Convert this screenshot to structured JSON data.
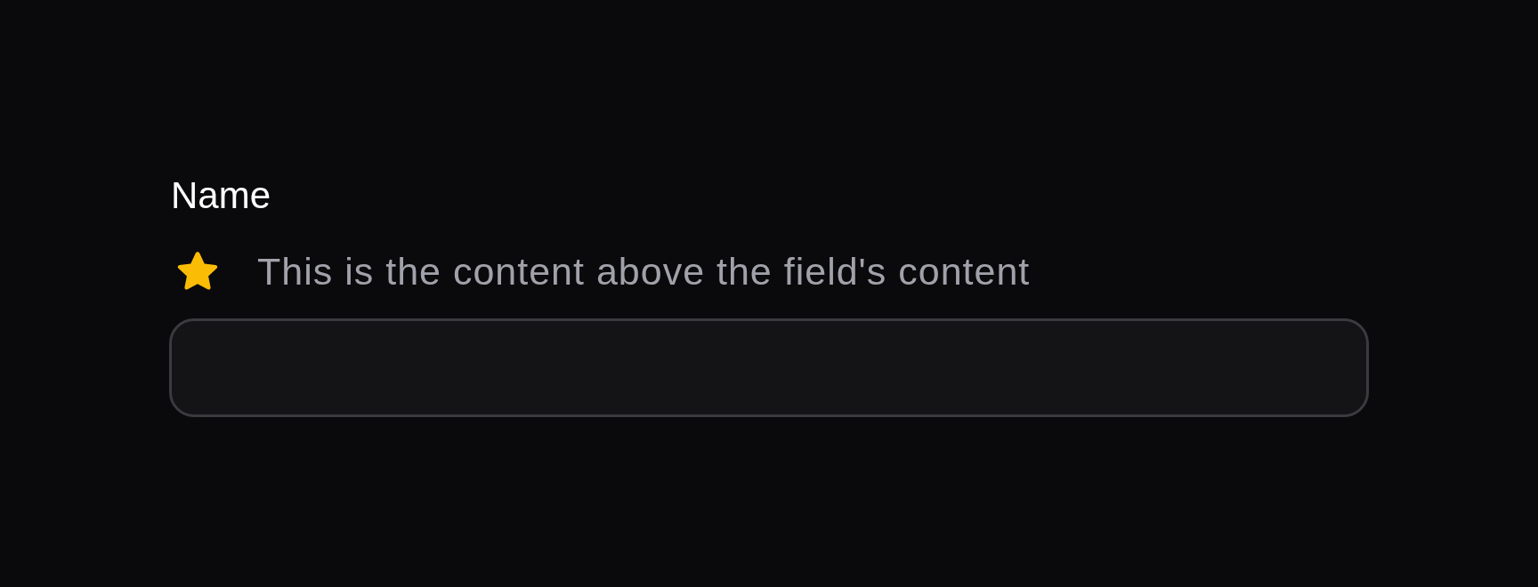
{
  "field": {
    "label": "Name",
    "description": "This is the content above the field's content"
  }
}
